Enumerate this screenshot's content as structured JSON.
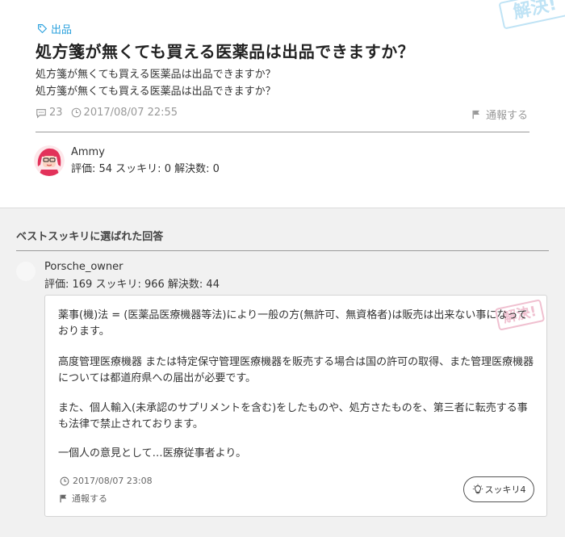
{
  "question": {
    "stamp": "解決!",
    "category": "出品",
    "title": "処方箋が無くても買える医薬品は出品できますか？",
    "body_lines": [
      "処方箋が無くても買える医薬品は出品できますか？",
      "処方箋が無くても買える医薬品は出品できますか？"
    ],
    "comment_count": "23",
    "timestamp": "2017/08/07 22:55",
    "report_label": "通報する",
    "asker": {
      "name": "Ammy",
      "stats": "評価: 54 スッキリ: 0 解決数: 0"
    }
  },
  "best_answer": {
    "section_title": "ベストスッキリに選ばれた回答",
    "answerer": {
      "name": "Porsche_owner",
      "stats": "評価: 169 スッキリ: 966 解決数: 44"
    },
    "stamp": "解決!",
    "paragraphs": [
      "薬事(機)法 = (医薬品医療機器等法)により一般の方(無許可、無資格者)は販売は出来ない事になっております。",
      "高度管理医療機器 または特定保守管理医療機器を販売する場合は国の許可の取得、また管理医療機器については都道府県への届出が必要です。",
      "また、個人輸入(未承認のサプリメントを含む)をしたものや、処方さたものを、第三者に転売する事も法律で禁止されております。",
      "一個人の意見として…医療従事者より。"
    ],
    "timestamp": "2017/08/07 23:08",
    "report_label": "通報する",
    "sukkiri_label": "スッキリ",
    "sukkiri_count": "4"
  },
  "colors": {
    "accent": "#29a0dd",
    "stamp_blue": "#bfe3f5",
    "stamp_pink": "#f0c0d0"
  },
  "icons": [
    "tag-icon",
    "comment-icon",
    "clock-icon",
    "flag-icon",
    "lightbulb-icon"
  ]
}
